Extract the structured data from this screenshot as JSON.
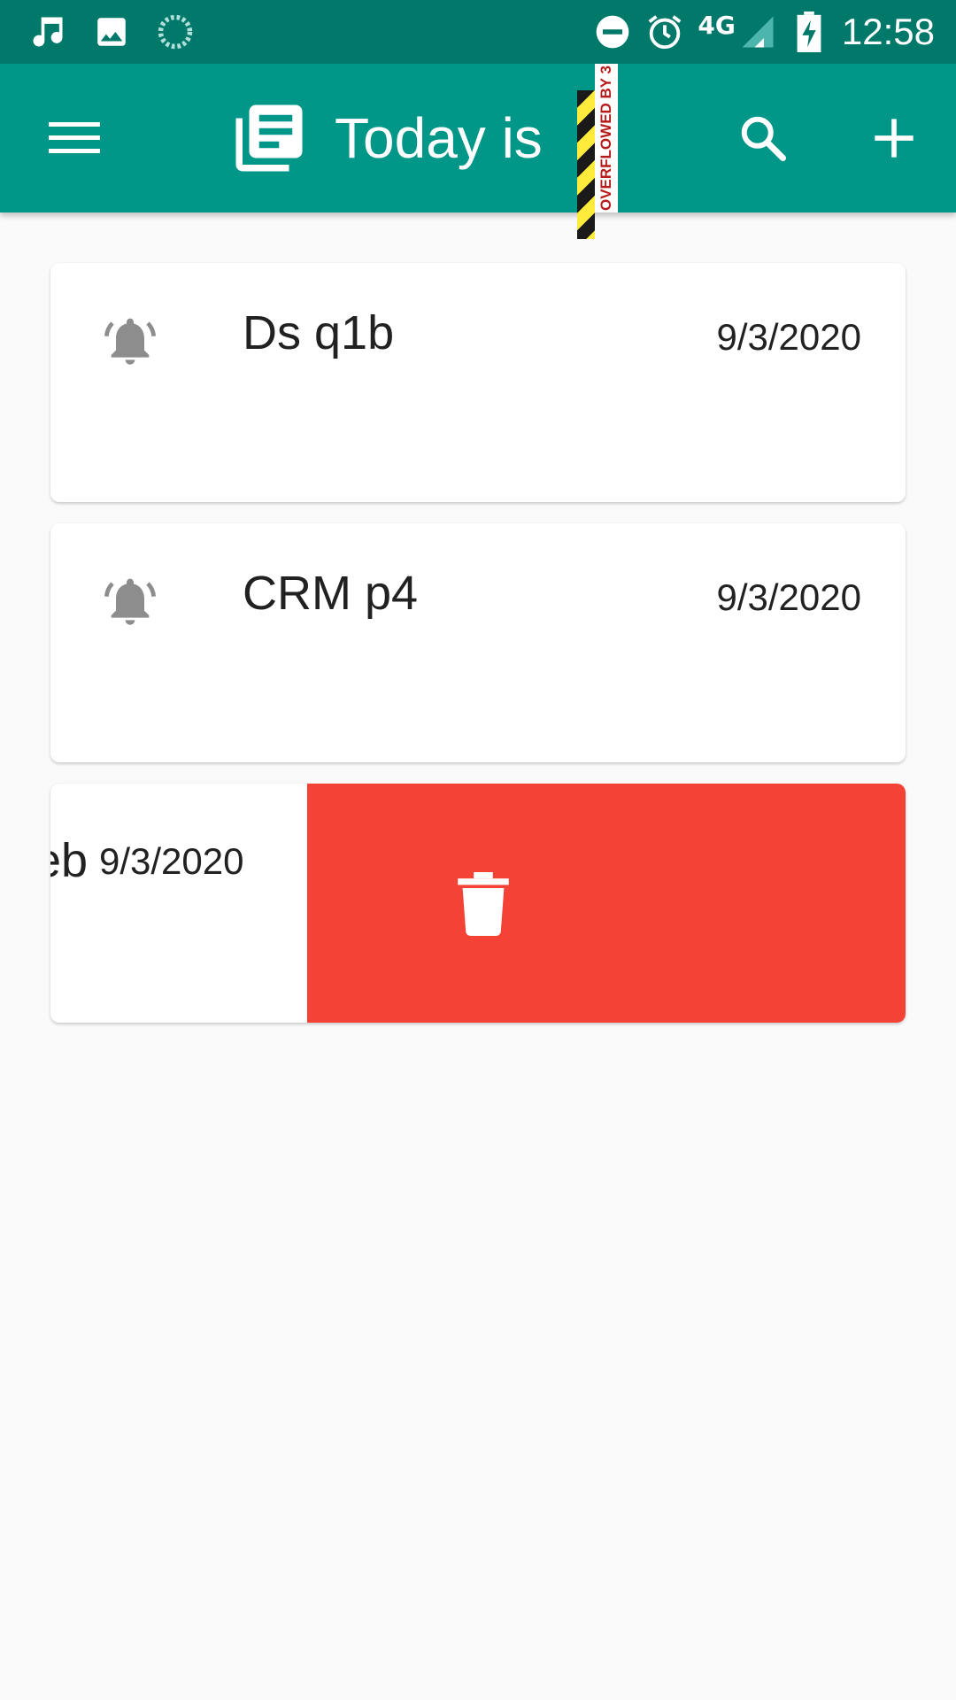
{
  "status_bar": {
    "time": "12:58",
    "network_label": "4G",
    "left_icons": [
      "music-note-icon",
      "image-icon",
      "sync-spinner-icon"
    ],
    "right_icons": [
      "do-not-disturb-icon",
      "alarm-icon",
      "signal-icon",
      "battery-charging-icon"
    ]
  },
  "app_bar": {
    "title": "Today is",
    "overflow_debug_label": "OVERFLOWED BY 3",
    "background": "#009688",
    "status_bar_background": "#00796b"
  },
  "notes": [
    {
      "title": "Ds q1b",
      "date": "9/3/2020",
      "icon": "bell-icon"
    },
    {
      "title": "CRM p4",
      "date": "9/3/2020",
      "icon": "bell-icon"
    }
  ],
  "swiped_note": {
    "title_visible": "web",
    "date": "9/3/2020",
    "action_icon": "delete-icon",
    "action_color": "#f44336"
  }
}
